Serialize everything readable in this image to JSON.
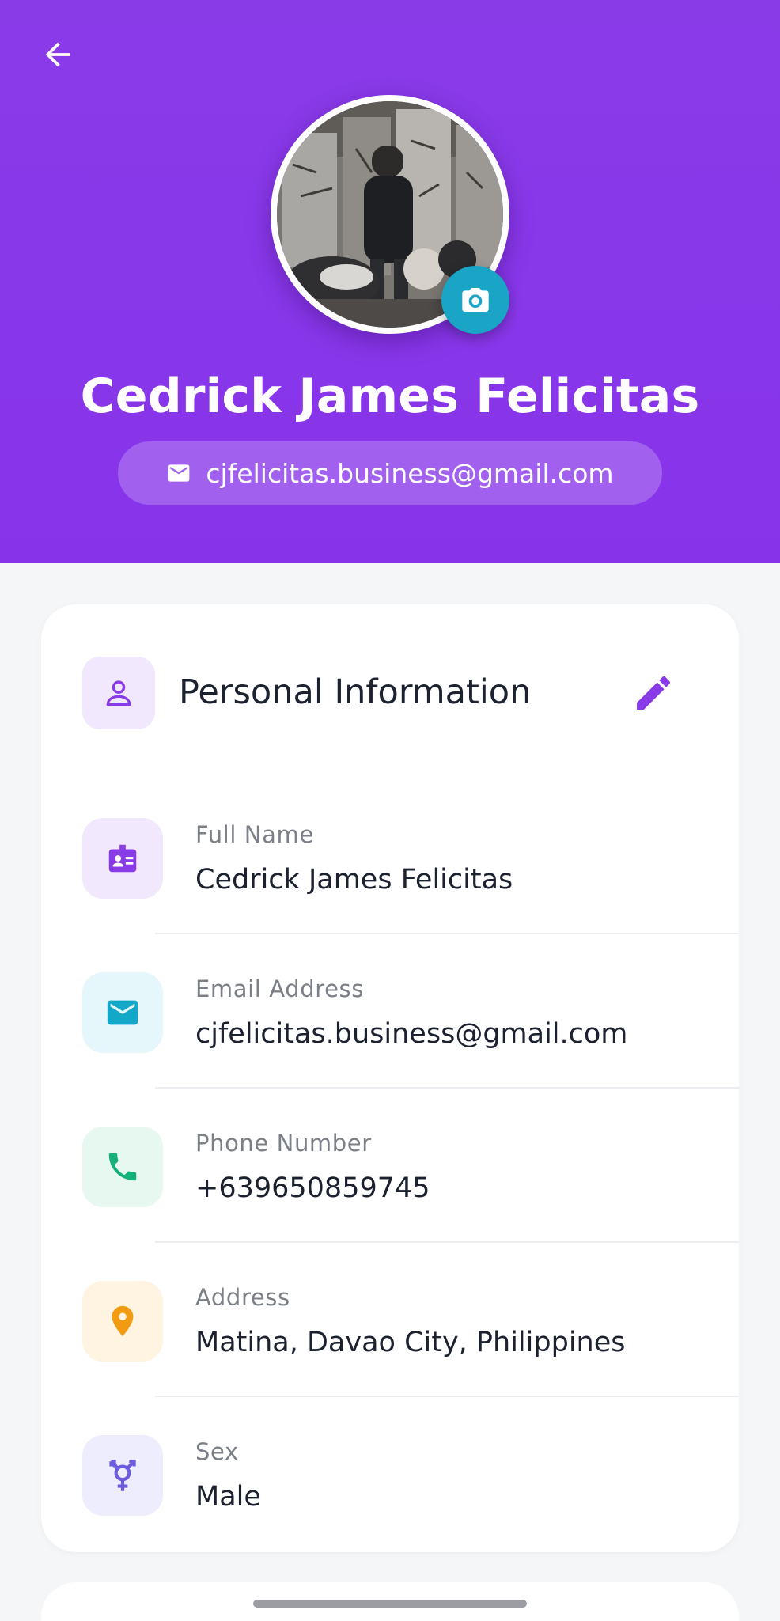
{
  "header": {
    "name": "Cedrick James Felicitas",
    "email": "cjfelicitas.business@gmail.com",
    "colors": {
      "background": "#8a3be8",
      "camera_button": "#1aa5c6"
    },
    "icons": {
      "back": "arrow-left-icon",
      "camera": "camera-icon",
      "email": "mail-icon"
    }
  },
  "personal_info": {
    "title": "Personal Information",
    "icons": {
      "header": "user-icon",
      "edit": "pencil-icon"
    },
    "fields": [
      {
        "label": "Full Name",
        "value": "Cedrick James Felicitas",
        "icon": "badge-icon",
        "color": "#8a3be8",
        "bg": "#f1e8fd"
      },
      {
        "label": "Email Address",
        "value": "cjfelicitas.business@gmail.com",
        "icon": "mail-icon",
        "color": "#13a7c8",
        "bg": "#e5f7fb"
      },
      {
        "label": "Phone Number",
        "value": "+639650859745",
        "icon": "phone-icon",
        "color": "#16b07a",
        "bg": "#e6f8ef"
      },
      {
        "label": "Address",
        "value": "Matina, Davao City, Philippines",
        "icon": "location-pin-icon",
        "color": "#f29a12",
        "bg": "#fff3e2"
      },
      {
        "label": "Sex",
        "value": "Male",
        "icon": "gender-icon",
        "color": "#6b5ce0",
        "bg": "#eeedfd"
      }
    ]
  }
}
